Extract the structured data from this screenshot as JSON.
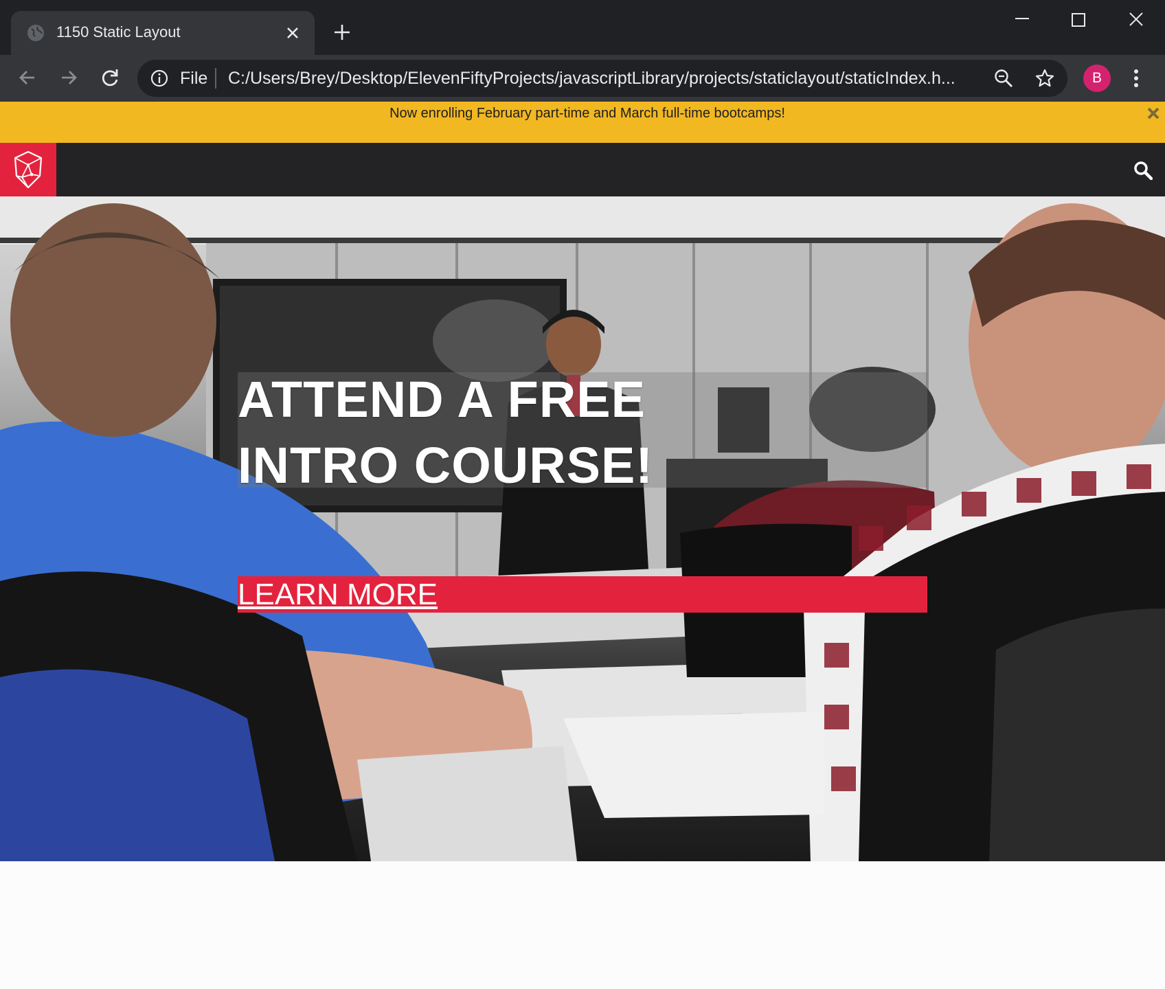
{
  "browser": {
    "tab_title": "1150 Static Layout",
    "omnibox_scheme": "File",
    "url": "C:/Users/Brey/Desktop/ElevenFiftyProjects/javascriptLibrary/projects/staticlayout/staticIndex.h...",
    "profile_initial": "B",
    "colors": {
      "chrome_dark": "#202124",
      "chrome_toolbar": "#35363a",
      "profile": "#d5226f"
    }
  },
  "banner": {
    "text": "Now enrolling February part-time and March full-time bootcamps!",
    "background": "#f2b822"
  },
  "nav": {
    "accent": "#e3233d",
    "background": "#232325"
  },
  "hero": {
    "headline_line1": "ATTEND A FREE",
    "headline_line2": "INTRO COURSE!",
    "cta_label": "LEARN MORE"
  }
}
